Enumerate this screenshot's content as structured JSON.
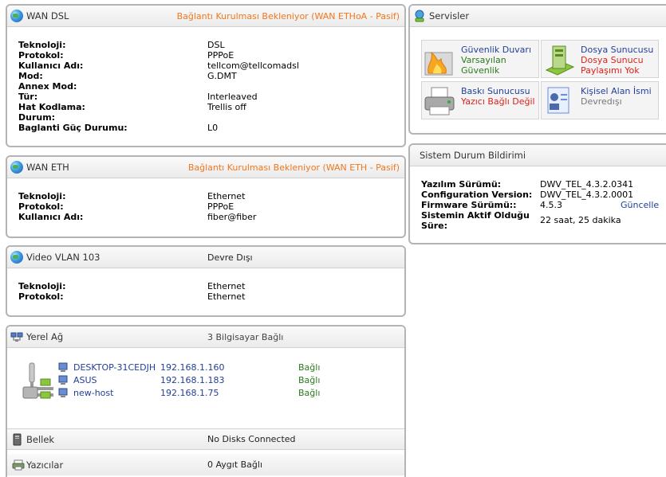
{
  "wan_dsl": {
    "title": "WAN DSL",
    "status": "Bağlantı Kurulması Bekleniyor (WAN ETHoA - Pasif)",
    "rows": [
      {
        "k": "Teknoloji:",
        "v": "DSL"
      },
      {
        "k": "Protokol:",
        "v": "PPPoE"
      },
      {
        "k": "Kullanıcı Adı:",
        "v": "tellcom@tellcomadsl"
      },
      {
        "k": "Mod:",
        "v": "G.DMT"
      },
      {
        "k": "Annex Mod:",
        "v": ""
      },
      {
        "k": "Tür:",
        "v": "Interleaved"
      },
      {
        "k": "Hat Kodlama:",
        "v": "Trellis off"
      },
      {
        "k": "Durum:",
        "v": ""
      },
      {
        "k": "Baglanti Güç Durumu:",
        "v": "L0"
      }
    ]
  },
  "wan_eth": {
    "title": "WAN ETH",
    "status": "Bağlantı Kurulması Bekleniyor (WAN ETH - Pasif)",
    "rows": [
      {
        "k": "Teknoloji:",
        "v": "Ethernet"
      },
      {
        "k": "Protokol:",
        "v": "PPPoE"
      },
      {
        "k": "Kullanıcı Adı:",
        "v": "fiber@fiber"
      }
    ]
  },
  "video_vlan": {
    "title": "Video VLAN 103",
    "status": "Devre Dışı",
    "rows": [
      {
        "k": "Teknoloji:",
        "v": "Ethernet"
      },
      {
        "k": "Protokol:",
        "v": "Ethernet"
      }
    ]
  },
  "lan": {
    "title": "Yerel Ağ",
    "status": "3 Bilgisayar Bağlı",
    "hosts": [
      {
        "name": "DESKTOP-31CEDJH",
        "ip": "192.168.1.160",
        "state": "Bağlı"
      },
      {
        "name": "ASUS",
        "ip": "192.168.1.183",
        "state": "Bağlı"
      },
      {
        "name": "new-host",
        "ip": "192.168.1.75",
        "state": "Bağlı"
      }
    ]
  },
  "storage": {
    "title": "Bellek",
    "status": "No Disks Connected"
  },
  "printers": {
    "title": "Yazıcılar",
    "status": "0 Aygıt Bağlı"
  },
  "services": {
    "title": "Servisler",
    "items": [
      {
        "name": "Güvenlik Duvarı",
        "line1": "Varsayılan",
        "line2": "Güvenlik",
        "color": "#2a7a1a",
        "icon": "firewall-icon"
      },
      {
        "name": "Dosya Sunucusu",
        "line1": "Dosya Sunucu",
        "line2": "Paylaşımı Yok",
        "color": "#e0201a",
        "icon": "file-server-icon"
      },
      {
        "name": "Baskı Sunucusu",
        "line1": "Yazıcı Bağlı Değil",
        "line2": "",
        "color": "#e0201a",
        "icon": "printer-icon"
      },
      {
        "name": "Kişisel Alan İsmi",
        "line1": "Devredışı",
        "line2": "",
        "color": "#777777",
        "icon": "personal-domain-icon"
      }
    ]
  },
  "system": {
    "title": "Sistem Durum Bildirimi",
    "sw_label": "Yazılım Sürümü:",
    "sw_value": "DWV_TEL_4.3.2.0341",
    "cfg_label": "Configuration Version:",
    "cfg_value": "DWV_TEL_4.3.2.0001",
    "fw_label": "Firmware Sürümü::",
    "fw_value": "4.5.3",
    "fw_state": "Güncelle",
    "up_label": "Sistemin Aktif Olduğu Süre:",
    "up_value": "22 saat, 25 dakika"
  }
}
